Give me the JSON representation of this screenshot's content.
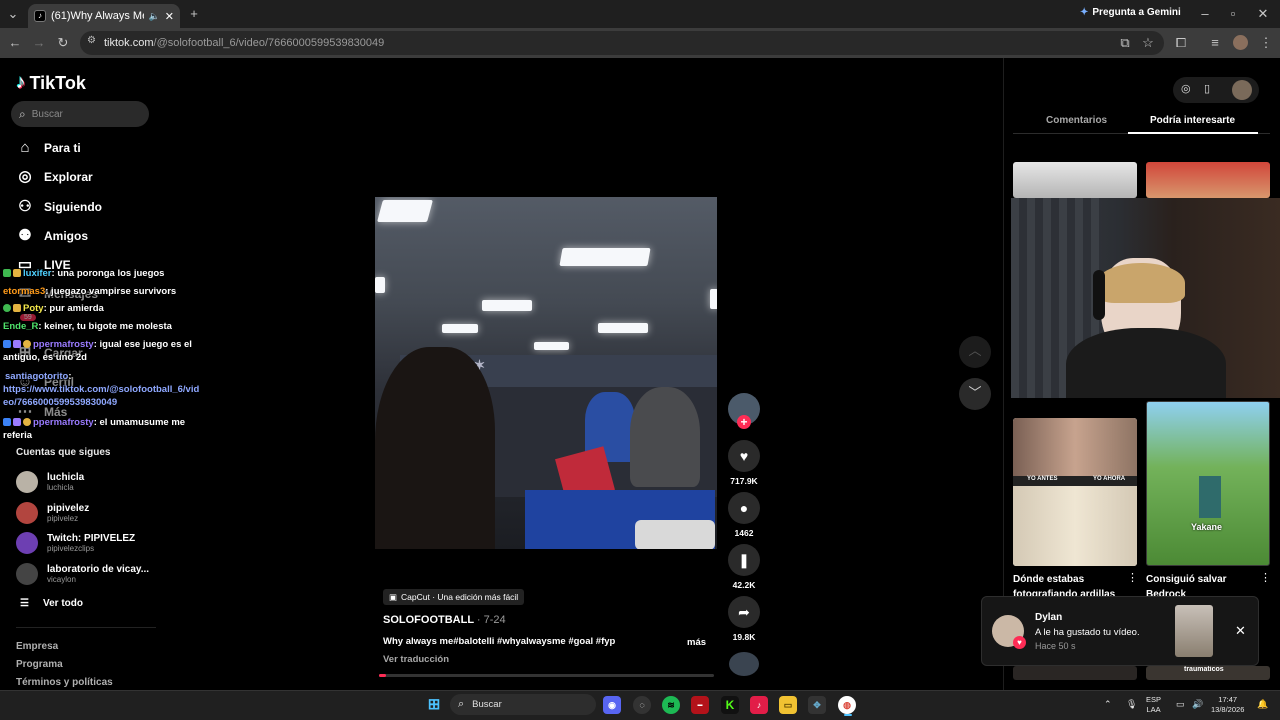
{
  "browser": {
    "tab_title": "(61)Why Always Me Balotelli",
    "url_domain": "tiktok.com",
    "url_path": "/@solofootball_6/video/7666000599539830049",
    "gemini_label": "Pregunta a Gemini"
  },
  "sidebar": {
    "logo": "TikTok",
    "search_placeholder": "Buscar",
    "nav": [
      {
        "label": "Para ti",
        "icon": "home-icon"
      },
      {
        "label": "Explorar",
        "icon": "compass-icon"
      },
      {
        "label": "Siguiendo",
        "icon": "following-icon"
      },
      {
        "label": "Amigos",
        "icon": "friends-icon"
      },
      {
        "label": "LIVE",
        "icon": "live-icon"
      },
      {
        "label": "Mensajes",
        "icon": "messages-icon"
      },
      {
        "label": "Cargar",
        "icon": "upload-icon"
      },
      {
        "label": "Perfil",
        "icon": "profile-icon"
      },
      {
        "label": "Más",
        "icon": "more-icon"
      }
    ],
    "messages_badge": "59",
    "following_header": "Cuentas que sigues",
    "following": [
      {
        "name": "luchicla",
        "handle": "luchicla"
      },
      {
        "name": "pipivelez",
        "handle": "pipivelez"
      },
      {
        "name": "Twitch: PIPIVELEZ",
        "handle": "pipivelezclips"
      },
      {
        "name": "laboratorio de vicay...",
        "handle": "vicaylon"
      }
    ],
    "see_all": "Ver todo",
    "footer": [
      "Empresa",
      "Programa",
      "Términos y políticas"
    ]
  },
  "chat": [
    {
      "user": "luxifer",
      "text": ": una poronga los juegos",
      "color": "#4fd1ff"
    },
    {
      "user": "etormas3",
      "text": ": juegazo vampirse survivors",
      "color": "#ff9b1a"
    },
    {
      "user": "Poty",
      "text": ": pur amierda",
      "color": "#f3e84a"
    },
    {
      "user": "Ende_R",
      "text": ": keiner, tu bigote me molesta",
      "color": "#4fe36b"
    },
    {
      "user": "ppermafrosty",
      "text": ": igual ese juego es el antiguo, es uno 2d",
      "color": "#9a7bff"
    },
    {
      "user": "santiagotorito",
      "text": ":",
      "color": "#8fa8ff"
    },
    {
      "user": "",
      "text": "https://www.tiktok.com/@solofootball_6/video/7666000599539830049",
      "color": "#8fa8ff"
    },
    {
      "user": "ppermafrosty",
      "text": ": el umamusume me referia",
      "color": "#9a7bff"
    }
  ],
  "video": {
    "capcut": "CapCut · Una edición más fácil",
    "author": "SOLOFOOTBALL",
    "date": "· 7-24",
    "description": "Why always me#balotelli #whyalwaysme #goal #fyp",
    "more": "más",
    "translate": "Ver traducción",
    "progress_fraction": 0.02
  },
  "actions": {
    "likes": "717.9K",
    "comments": "1462",
    "saves": "42.2K",
    "shares": "19.8K"
  },
  "right_panel": {
    "tabs": [
      "Comentarios",
      "Podría interesarte"
    ],
    "active_tab": "Podría interesarte",
    "cards": [
      {
        "title": "Dónde estabas fotografiando ardillas",
        "captions": [
          "YO ANTES",
          "YO AHORA"
        ]
      },
      {
        "title": "Consiguió salvar Bedrock",
        "overlay": "Yakane"
      }
    ],
    "partial_caption": "traumaticos"
  },
  "notification": {
    "name": "Dylan",
    "text": "A le ha gustado tu vídeo.",
    "time": "Hace 50 s"
  },
  "taskbar": {
    "search_label": "Buscar",
    "lang_top": "ESP",
    "lang_bottom": "LAA",
    "time": "17:47",
    "date": "13/8/2026"
  },
  "colors": {
    "tiktok_red": "#fe2c55",
    "accent_blue": "#8fa8ff"
  }
}
